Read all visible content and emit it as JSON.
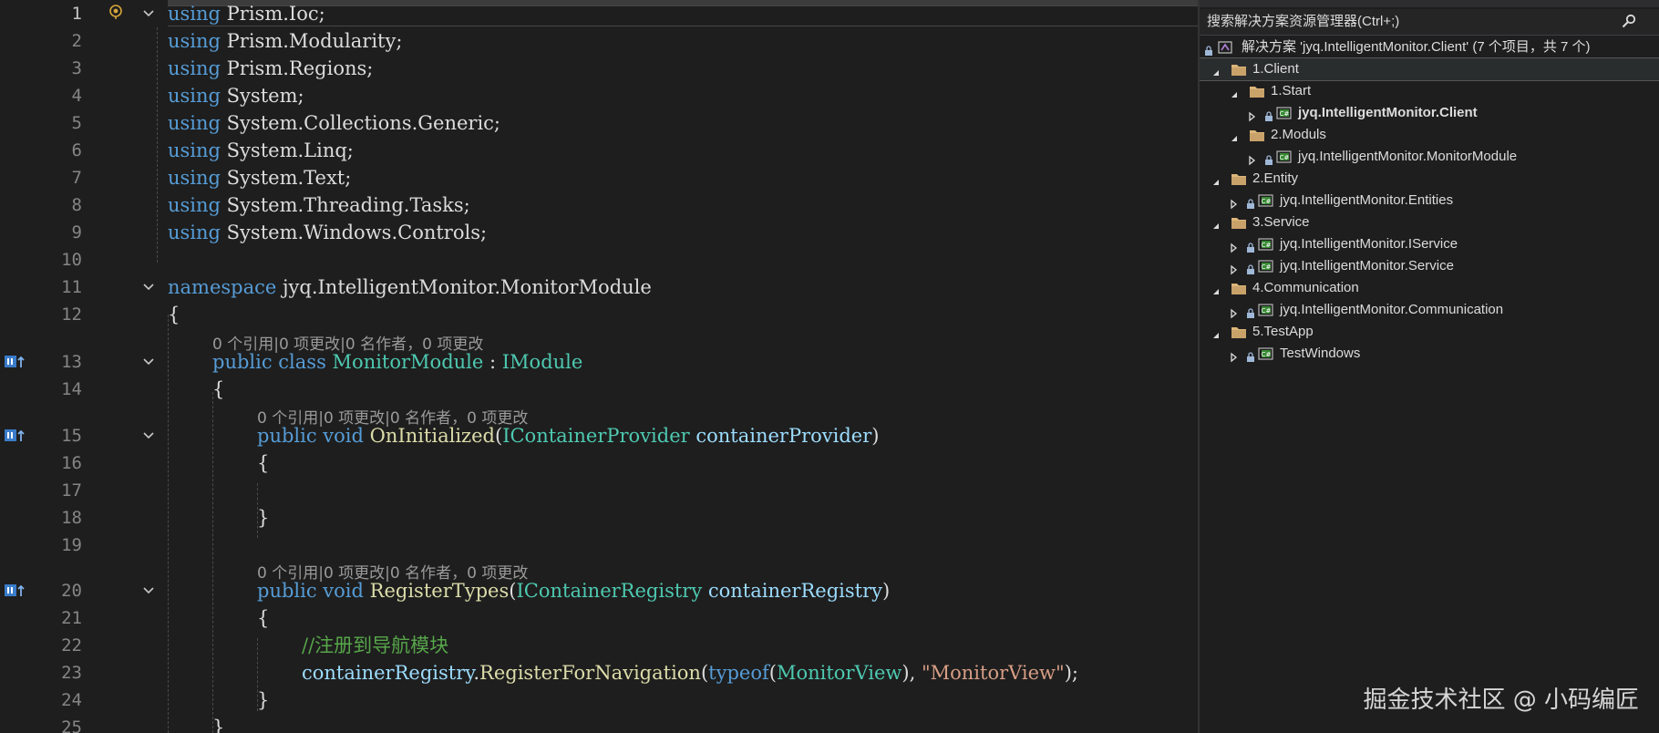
{
  "editor": {
    "lines": [
      {
        "n": "1",
        "active": true,
        "tokens": [
          [
            "kw",
            "using"
          ],
          [
            "",
            " Prism.Ioc;"
          ]
        ]
      },
      {
        "n": "2",
        "tokens": [
          [
            "kw",
            "using"
          ],
          [
            "",
            " Prism.Modularity;"
          ]
        ]
      },
      {
        "n": "3",
        "tokens": [
          [
            "kw",
            "using"
          ],
          [
            "",
            " Prism.Regions;"
          ]
        ]
      },
      {
        "n": "4",
        "tokens": [
          [
            "kw",
            "using"
          ],
          [
            "",
            " System;"
          ]
        ]
      },
      {
        "n": "5",
        "tokens": [
          [
            "kw",
            "using"
          ],
          [
            "",
            " System.Collections.Generic;"
          ]
        ]
      },
      {
        "n": "6",
        "tokens": [
          [
            "kw",
            "using"
          ],
          [
            "",
            " System.Linq;"
          ]
        ]
      },
      {
        "n": "7",
        "tokens": [
          [
            "kw",
            "using"
          ],
          [
            "",
            " System.Text;"
          ]
        ]
      },
      {
        "n": "8",
        "tokens": [
          [
            "kw",
            "using"
          ],
          [
            "",
            " System.Threading.Tasks;"
          ]
        ]
      },
      {
        "n": "9",
        "tokens": [
          [
            "kw",
            "using"
          ],
          [
            "",
            " System.Windows.Controls;"
          ]
        ]
      },
      {
        "n": "10",
        "tokens": []
      },
      {
        "n": "11",
        "tokens": [
          [
            "kw",
            "namespace"
          ],
          [
            "",
            " jyq.IntelligentMonitor.MonitorModule"
          ]
        ]
      },
      {
        "n": "12",
        "tokens": [
          [
            "",
            "{"
          ]
        ]
      },
      {
        "n": "13",
        "tokens": [
          [
            "kw",
            "public"
          ],
          [
            "",
            " "
          ],
          [
            "kw",
            "class"
          ],
          [
            "",
            " "
          ],
          [
            "ty",
            "MonitorModule"
          ],
          [
            "",
            " : "
          ],
          [
            "ty",
            "IModule"
          ]
        ]
      },
      {
        "n": "14",
        "tokens": [
          [
            "",
            "{"
          ]
        ]
      },
      {
        "n": "15",
        "tokens": [
          [
            "kw",
            "public"
          ],
          [
            "",
            " "
          ],
          [
            "kw",
            "void"
          ],
          [
            "",
            " "
          ],
          [
            "mt",
            "OnInitialized"
          ],
          [
            "",
            "("
          ],
          [
            "ty",
            "IContainerProvider"
          ],
          [
            "",
            " "
          ],
          [
            "pr",
            "containerProvider"
          ],
          [
            "",
            ")"
          ]
        ]
      },
      {
        "n": "16",
        "tokens": [
          [
            "",
            "{"
          ]
        ]
      },
      {
        "n": "17",
        "tokens": []
      },
      {
        "n": "18",
        "tokens": [
          [
            "",
            "}"
          ]
        ]
      },
      {
        "n": "19",
        "tokens": []
      },
      {
        "n": "20",
        "tokens": [
          [
            "kw",
            "public"
          ],
          [
            "",
            " "
          ],
          [
            "kw",
            "void"
          ],
          [
            "",
            " "
          ],
          [
            "mt",
            "RegisterTypes"
          ],
          [
            "",
            "("
          ],
          [
            "ty",
            "IContainerRegistry"
          ],
          [
            "",
            " "
          ],
          [
            "pr",
            "containerRegistry"
          ],
          [
            "",
            ")"
          ]
        ]
      },
      {
        "n": "21",
        "tokens": [
          [
            "",
            "{"
          ]
        ]
      },
      {
        "n": "22",
        "tokens": [
          [
            "cm",
            "//注册到导航模块"
          ]
        ]
      },
      {
        "n": "23",
        "tokens": [
          [
            "pr",
            "containerRegistry"
          ],
          [
            "",
            "."
          ],
          [
            "mt",
            "RegisterForNavigation"
          ],
          [
            "",
            "("
          ],
          [
            "kw",
            "typeof"
          ],
          [
            "",
            "("
          ],
          [
            "ty",
            "MonitorView"
          ],
          [
            "",
            "), "
          ],
          [
            "st",
            "\"MonitorView\""
          ],
          [
            "",
            ");"
          ]
        ]
      },
      {
        "n": "24",
        "tokens": [
          [
            "",
            "}"
          ]
        ]
      },
      {
        "n": "25",
        "tokens": [
          [
            "",
            "}"
          ]
        ]
      }
    ],
    "codelens": [
      {
        "text": "0 个引用|0 项更改|0 名作者，0 项更改"
      },
      {
        "text": "0 个引用|0 项更改|0 名作者，0 项更改"
      },
      {
        "text": "0 个引用|0 项更改|0 名作者，0 项更改"
      }
    ]
  },
  "explorer": {
    "search_placeholder": "搜索解决方案资源管理器(Ctrl+;)",
    "solution_label": "解决方案 'jyq.IntelligentMonitor.Client' (7 个项目，共 7 个)",
    "items": [
      {
        "type": "folder",
        "label": "1.Client",
        "expanded": true,
        "selected": true
      },
      {
        "type": "folder",
        "label": "1.Start",
        "expanded": true
      },
      {
        "type": "project",
        "label": "jyq.IntelligentMonitor.Client",
        "bold": true
      },
      {
        "type": "folder",
        "label": "2.Moduls",
        "expanded": true
      },
      {
        "type": "project",
        "label": "jyq.IntelligentMonitor.MonitorModule"
      },
      {
        "type": "folder",
        "label": "2.Entity",
        "expanded": true
      },
      {
        "type": "project",
        "label": "jyq.IntelligentMonitor.Entities"
      },
      {
        "type": "folder",
        "label": "3.Service",
        "expanded": true
      },
      {
        "type": "project",
        "label": "jyq.IntelligentMonitor.IService"
      },
      {
        "type": "project",
        "label": "jyq.IntelligentMonitor.Service"
      },
      {
        "type": "folder",
        "label": "4.Communication",
        "expanded": true
      },
      {
        "type": "project",
        "label": "jyq.IntelligentMonitor.Communication"
      },
      {
        "type": "folder",
        "label": "5.TestApp",
        "expanded": true
      },
      {
        "type": "project",
        "label": "TestWindows"
      }
    ]
  },
  "watermark": "掘金技术社区 @ 小码编匠",
  "colors": {
    "keyword": "#569cd6",
    "type": "#4ec9b0",
    "method": "#dcdcaa",
    "param": "#9cdcfe",
    "comment": "#57a64a",
    "string": "#d69d85",
    "lens": "#9a9a9a"
  }
}
